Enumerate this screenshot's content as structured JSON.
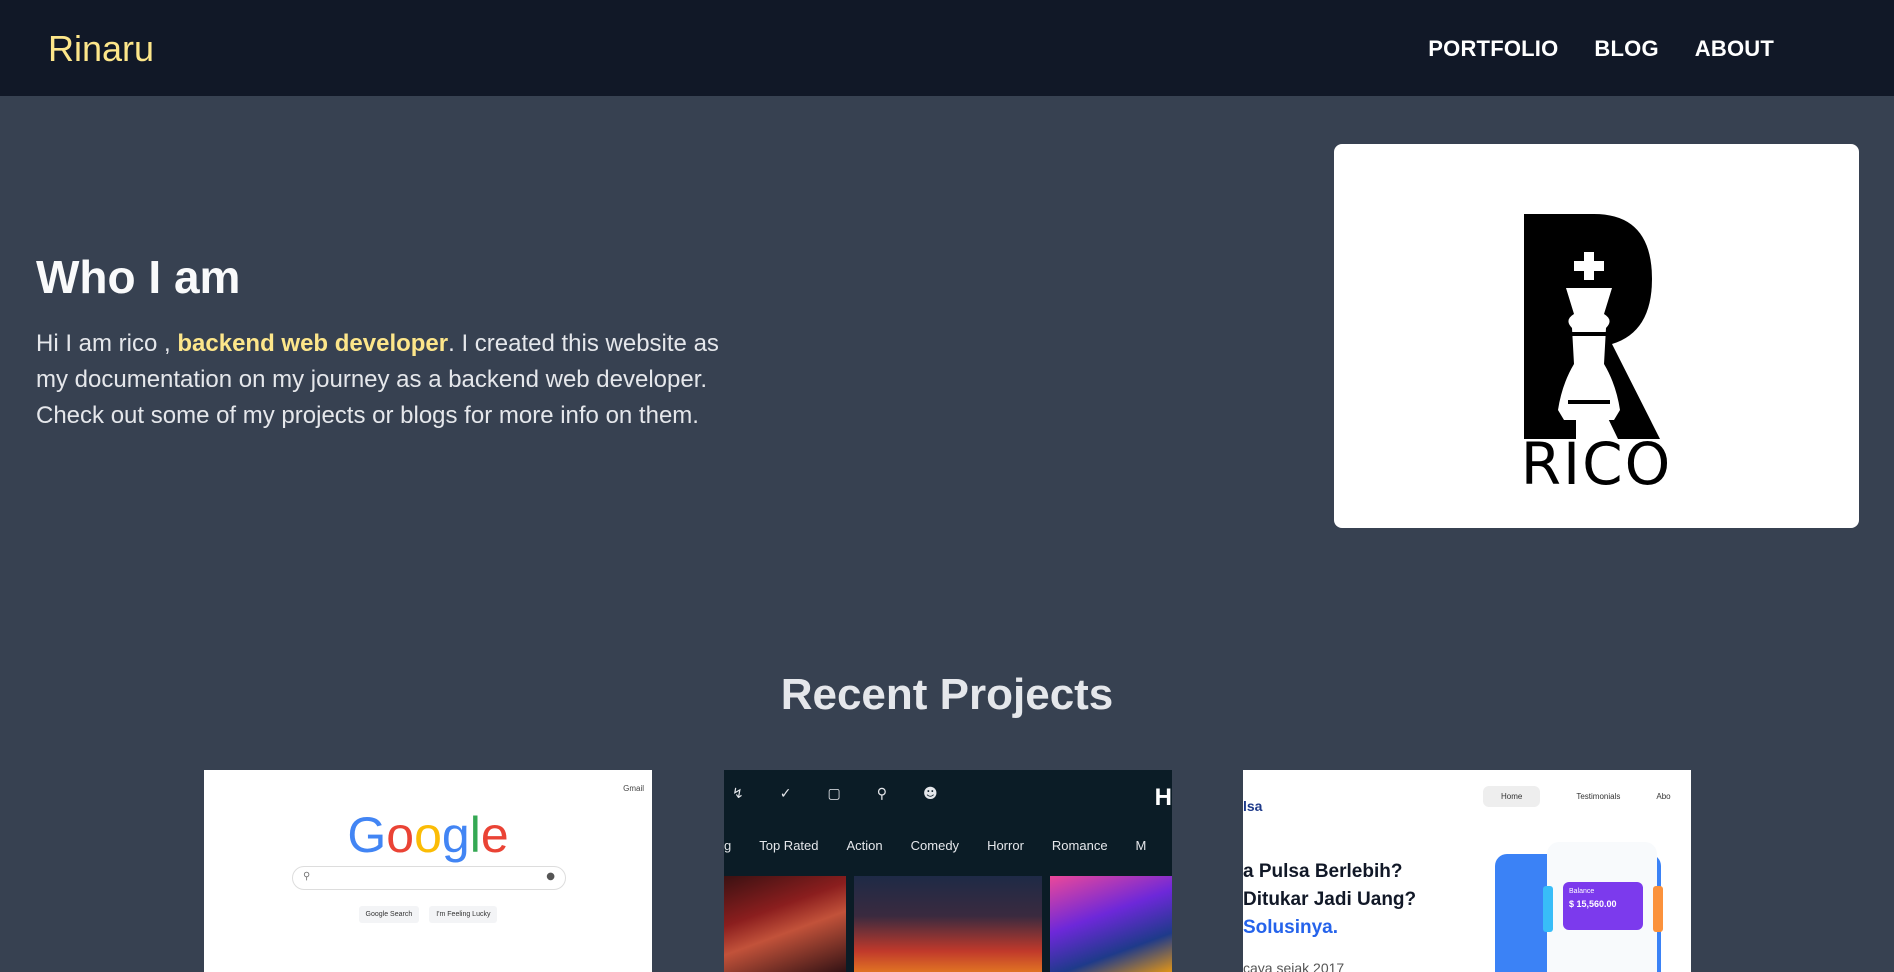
{
  "nav": {
    "brand": "Rinaru",
    "links": [
      "PORTFOLIO",
      "BLOG",
      "ABOUT"
    ]
  },
  "hero": {
    "title": "Who I am",
    "text_before": "Hi I am rico , ",
    "highlight": "backend web developer",
    "text_after": ". I created this website as my documentation on my journey as a backend web developer. Check out some of my projects or blogs for more info on them."
  },
  "logo": {
    "text": "RICO"
  },
  "projects": {
    "title": "Recent Projects",
    "google": {
      "gmail": "Gmail",
      "logo": "Google",
      "buttons": [
        "Google Search",
        "I'm Feeling Lucky"
      ]
    },
    "movie": {
      "brand_partial": "H",
      "tabs": [
        "g",
        "Top Rated",
        "Action",
        "Comedy",
        "Horror",
        "Romance",
        "M"
      ]
    },
    "pulsa": {
      "brand_partial": "lsa",
      "nav": [
        "Home",
        "Testimonials",
        "Abo"
      ],
      "heading_line1": "a Pulsa Berlebih?",
      "heading_line2": "Ditukar Jadi Uang?",
      "heading_line3": "Solusinya.",
      "sub": "caya sejak 2017",
      "card_label": "Balance",
      "card_amount": "$ 15,560.00"
    }
  },
  "colors": {
    "nav_bg": "#111827",
    "page_bg": "#374151",
    "accent": "#fde68a"
  }
}
